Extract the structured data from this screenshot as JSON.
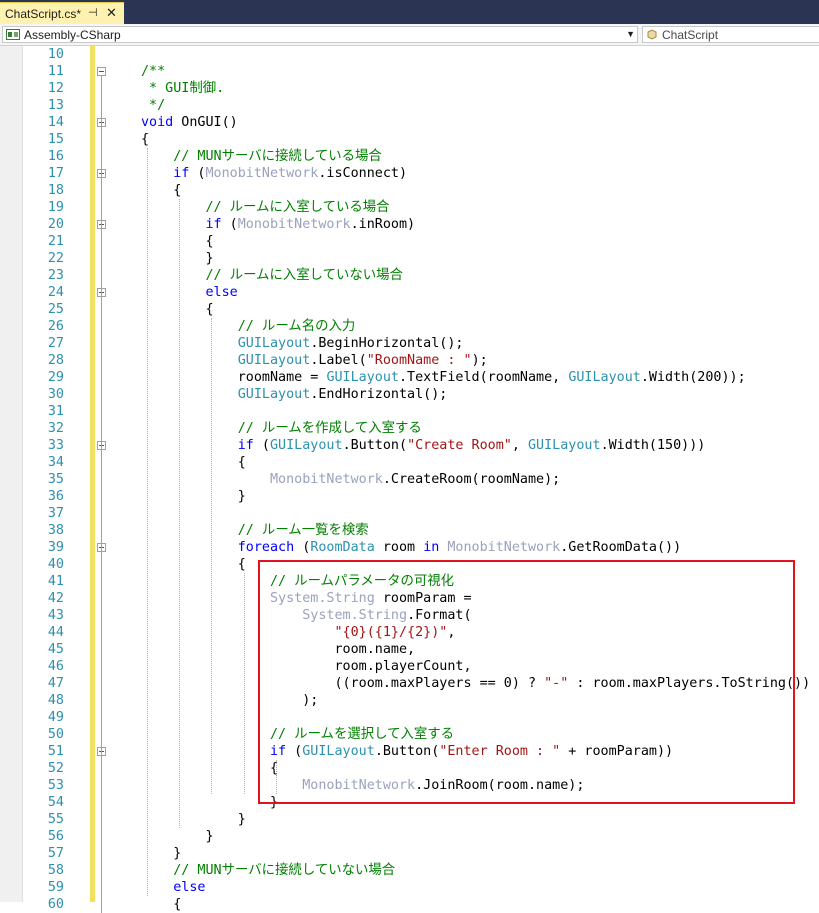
{
  "tab": {
    "title": "ChatScript.cs*",
    "pin_glyph": "⊣",
    "close_glyph": "✕"
  },
  "nav": {
    "project": "Assembly-CSharp",
    "member": "ChatScript"
  },
  "colors": {
    "keyword": "#0000ff",
    "comment": "#008000",
    "string": "#a31515",
    "type": "#2b91af",
    "line_number": "#2b91af",
    "highlight_box": "#e0141e",
    "change_bar": "#f2e05f"
  },
  "lines": [
    {
      "num": "10",
      "tokens": []
    },
    {
      "num": "11",
      "tokens": [
        {
          "t": "/**",
          "c": "cm"
        }
      ]
    },
    {
      "num": "12",
      "tokens": [
        {
          "t": " * GUI制御.",
          "c": "cm"
        }
      ]
    },
    {
      "num": "13",
      "tokens": [
        {
          "t": " */",
          "c": "cm"
        }
      ]
    },
    {
      "num": "14",
      "tokens": [
        {
          "t": "void",
          "c": "kw"
        },
        {
          "t": " OnGUI()",
          "c": ""
        }
      ]
    },
    {
      "num": "15",
      "tokens": [
        {
          "t": "{",
          "c": ""
        }
      ]
    },
    {
      "num": "16",
      "tokens": [
        {
          "t": "    // MUNサーバに接続している場合",
          "c": "cm"
        }
      ]
    },
    {
      "num": "17",
      "tokens": [
        {
          "t": "    ",
          "c": ""
        },
        {
          "t": "if",
          "c": "kw"
        },
        {
          "t": " (",
          "c": ""
        },
        {
          "t": "MonobitNetwork",
          "c": "gr"
        },
        {
          "t": ".isConnect)",
          "c": ""
        }
      ]
    },
    {
      "num": "18",
      "tokens": [
        {
          "t": "    {",
          "c": ""
        }
      ]
    },
    {
      "num": "19",
      "tokens": [
        {
          "t": "        // ルームに入室している場合",
          "c": "cm"
        }
      ]
    },
    {
      "num": "20",
      "tokens": [
        {
          "t": "        ",
          "c": ""
        },
        {
          "t": "if",
          "c": "kw"
        },
        {
          "t": " (",
          "c": ""
        },
        {
          "t": "MonobitNetwork",
          "c": "gr"
        },
        {
          "t": ".inRoom)",
          "c": ""
        }
      ]
    },
    {
      "num": "21",
      "tokens": [
        {
          "t": "        {",
          "c": ""
        }
      ]
    },
    {
      "num": "22",
      "tokens": [
        {
          "t": "        }",
          "c": ""
        }
      ]
    },
    {
      "num": "23",
      "tokens": [
        {
          "t": "        // ルームに入室していない場合",
          "c": "cm"
        }
      ]
    },
    {
      "num": "24",
      "tokens": [
        {
          "t": "        ",
          "c": ""
        },
        {
          "t": "else",
          "c": "kw"
        }
      ]
    },
    {
      "num": "25",
      "tokens": [
        {
          "t": "        {",
          "c": ""
        }
      ]
    },
    {
      "num": "26",
      "tokens": [
        {
          "t": "            // ルーム名の入力",
          "c": "cm"
        }
      ]
    },
    {
      "num": "27",
      "tokens": [
        {
          "t": "            ",
          "c": ""
        },
        {
          "t": "GUILayout",
          "c": "ty"
        },
        {
          "t": ".BeginHorizontal();",
          "c": ""
        }
      ]
    },
    {
      "num": "28",
      "tokens": [
        {
          "t": "            ",
          "c": ""
        },
        {
          "t": "GUILayout",
          "c": "ty"
        },
        {
          "t": ".Label(",
          "c": ""
        },
        {
          "t": "\"RoomName : \"",
          "c": "st"
        },
        {
          "t": ");",
          "c": ""
        }
      ]
    },
    {
      "num": "29",
      "tokens": [
        {
          "t": "            roomName = ",
          "c": ""
        },
        {
          "t": "GUILayout",
          "c": "ty"
        },
        {
          "t": ".TextField(roomName, ",
          "c": ""
        },
        {
          "t": "GUILayout",
          "c": "ty"
        },
        {
          "t": ".Width(200));",
          "c": ""
        }
      ]
    },
    {
      "num": "30",
      "tokens": [
        {
          "t": "            ",
          "c": ""
        },
        {
          "t": "GUILayout",
          "c": "ty"
        },
        {
          "t": ".EndHorizontal();",
          "c": ""
        }
      ]
    },
    {
      "num": "31",
      "tokens": []
    },
    {
      "num": "32",
      "tokens": [
        {
          "t": "            // ルームを作成して入室する",
          "c": "cm"
        }
      ]
    },
    {
      "num": "33",
      "tokens": [
        {
          "t": "            ",
          "c": ""
        },
        {
          "t": "if",
          "c": "kw"
        },
        {
          "t": " (",
          "c": ""
        },
        {
          "t": "GUILayout",
          "c": "ty"
        },
        {
          "t": ".Button(",
          "c": ""
        },
        {
          "t": "\"Create Room\"",
          "c": "st"
        },
        {
          "t": ", ",
          "c": ""
        },
        {
          "t": "GUILayout",
          "c": "ty"
        },
        {
          "t": ".Width(150)))",
          "c": ""
        }
      ]
    },
    {
      "num": "34",
      "tokens": [
        {
          "t": "            {",
          "c": ""
        }
      ]
    },
    {
      "num": "35",
      "tokens": [
        {
          "t": "                ",
          "c": ""
        },
        {
          "t": "MonobitNetwork",
          "c": "gr"
        },
        {
          "t": ".CreateRoom(roomName);",
          "c": ""
        }
      ]
    },
    {
      "num": "36",
      "tokens": [
        {
          "t": "            }",
          "c": ""
        }
      ]
    },
    {
      "num": "37",
      "tokens": []
    },
    {
      "num": "38",
      "tokens": [
        {
          "t": "            // ルーム一覧を検索",
          "c": "cm"
        }
      ]
    },
    {
      "num": "39",
      "tokens": [
        {
          "t": "            ",
          "c": ""
        },
        {
          "t": "foreach",
          "c": "kw"
        },
        {
          "t": " (",
          "c": ""
        },
        {
          "t": "RoomData",
          "c": "ty"
        },
        {
          "t": " room ",
          "c": ""
        },
        {
          "t": "in",
          "c": "kw"
        },
        {
          "t": " ",
          "c": ""
        },
        {
          "t": "MonobitNetwork",
          "c": "gr"
        },
        {
          "t": ".GetRoomData())",
          "c": ""
        }
      ]
    },
    {
      "num": "40",
      "tokens": [
        {
          "t": "            {",
          "c": ""
        }
      ]
    },
    {
      "num": "41",
      "tokens": [
        {
          "t": "                // ルームパラメータの可視化",
          "c": "cm"
        }
      ]
    },
    {
      "num": "42",
      "tokens": [
        {
          "t": "                ",
          "c": ""
        },
        {
          "t": "System.String",
          "c": "gr"
        },
        {
          "t": " roomParam =",
          "c": ""
        }
      ]
    },
    {
      "num": "43",
      "tokens": [
        {
          "t": "                    ",
          "c": ""
        },
        {
          "t": "System.String",
          "c": "gr"
        },
        {
          "t": ".Format(",
          "c": ""
        }
      ]
    },
    {
      "num": "44",
      "tokens": [
        {
          "t": "                        ",
          "c": ""
        },
        {
          "t": "\"{0}({1}/{2})\"",
          "c": "st"
        },
        {
          "t": ",",
          "c": ""
        }
      ]
    },
    {
      "num": "45",
      "tokens": [
        {
          "t": "                        room.name,",
          "c": ""
        }
      ]
    },
    {
      "num": "46",
      "tokens": [
        {
          "t": "                        room.playerCount,",
          "c": ""
        }
      ]
    },
    {
      "num": "47",
      "tokens": [
        {
          "t": "                        ((room.maxPlayers == 0) ? ",
          "c": ""
        },
        {
          "t": "\"-\"",
          "c": "st"
        },
        {
          "t": " : room.maxPlayers.ToString())",
          "c": ""
        }
      ]
    },
    {
      "num": "48",
      "tokens": [
        {
          "t": "                    );",
          "c": ""
        }
      ]
    },
    {
      "num": "49",
      "tokens": []
    },
    {
      "num": "50",
      "tokens": [
        {
          "t": "                // ルームを選択して入室する",
          "c": "cm"
        }
      ]
    },
    {
      "num": "51",
      "tokens": [
        {
          "t": "                ",
          "c": ""
        },
        {
          "t": "if",
          "c": "kw"
        },
        {
          "t": " (",
          "c": ""
        },
        {
          "t": "GUILayout",
          "c": "ty"
        },
        {
          "t": ".Button(",
          "c": ""
        },
        {
          "t": "\"Enter Room : \"",
          "c": "st"
        },
        {
          "t": " + roomParam))",
          "c": ""
        }
      ]
    },
    {
      "num": "52",
      "tokens": [
        {
          "t": "                {",
          "c": ""
        }
      ]
    },
    {
      "num": "53",
      "tokens": [
        {
          "t": "                    ",
          "c": ""
        },
        {
          "t": "MonobitNetwork",
          "c": "gr"
        },
        {
          "t": ".JoinRoom(room.name);",
          "c": ""
        }
      ]
    },
    {
      "num": "54",
      "tokens": [
        {
          "t": "                }",
          "c": ""
        }
      ]
    },
    {
      "num": "55",
      "tokens": [
        {
          "t": "            }",
          "c": ""
        }
      ]
    },
    {
      "num": "56",
      "tokens": [
        {
          "t": "        }",
          "c": ""
        }
      ]
    },
    {
      "num": "57",
      "tokens": [
        {
          "t": "    }",
          "c": ""
        }
      ]
    },
    {
      "num": "58",
      "tokens": [
        {
          "t": "    // MUNサーバに接続していない場合",
          "c": "cm"
        }
      ]
    },
    {
      "num": "59",
      "tokens": [
        {
          "t": "    ",
          "c": ""
        },
        {
          "t": "else",
          "c": "kw"
        }
      ]
    },
    {
      "num": "60",
      "tokens": [
        {
          "t": "    {",
          "c": ""
        }
      ]
    }
  ]
}
